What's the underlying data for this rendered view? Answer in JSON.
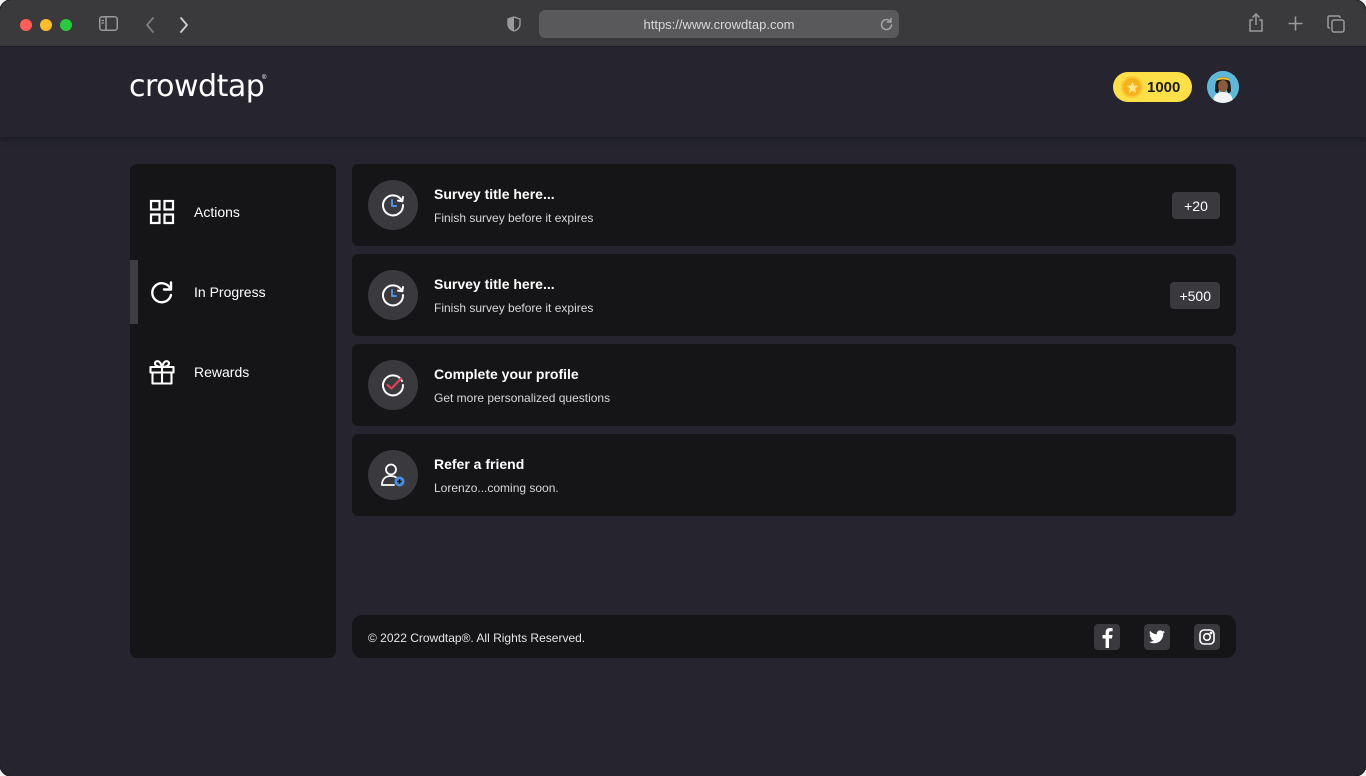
{
  "browser": {
    "url": "https://www.crowdtap.com",
    "icons": [
      "sidebar-toggle-icon",
      "back-icon",
      "forward-icon",
      "shield-icon",
      "reload-icon",
      "share-icon",
      "new-tab-icon",
      "tabs-overview-icon"
    ]
  },
  "header": {
    "logo": "crowdtap",
    "logo_mark": "®",
    "coins": "1000",
    "colors": {
      "coin_badge": "#fde047",
      "coin": "#f6b21a"
    }
  },
  "sidebar": {
    "items": [
      {
        "label": "Actions",
        "icon": "grid-icon",
        "active": false
      },
      {
        "label": "In Progress",
        "icon": "refresh-icon",
        "active": true
      },
      {
        "label": "Rewards",
        "icon": "gift-icon",
        "active": false
      }
    ]
  },
  "tasks": [
    {
      "title": "Survey title here...",
      "subtitle": "Finish survey before it expires",
      "points": "+20",
      "icon": "clock-icon"
    },
    {
      "title": "Survey title here...",
      "subtitle": "Finish survey before it expires",
      "points": "+500",
      "icon": "clock-icon"
    },
    {
      "title": "Complete your profile",
      "subtitle": "Get more personalized questions",
      "icon": "check-circle-icon"
    },
    {
      "title": "Refer a friend",
      "subtitle": "Lorenzo...coming soon.",
      "icon": "add-user-icon"
    }
  ],
  "footer": {
    "copyright": "© 2022 Crowdtap®. All Rights Reserved.",
    "social": [
      "facebook-icon",
      "twitter-icon",
      "instagram-icon"
    ]
  },
  "colors": {
    "page_bg": "#26252f",
    "panel_bg": "#151517",
    "chip_bg": "#3a3a3e",
    "accent_blue": "#4a90e2",
    "accent_red": "#e0405a"
  }
}
